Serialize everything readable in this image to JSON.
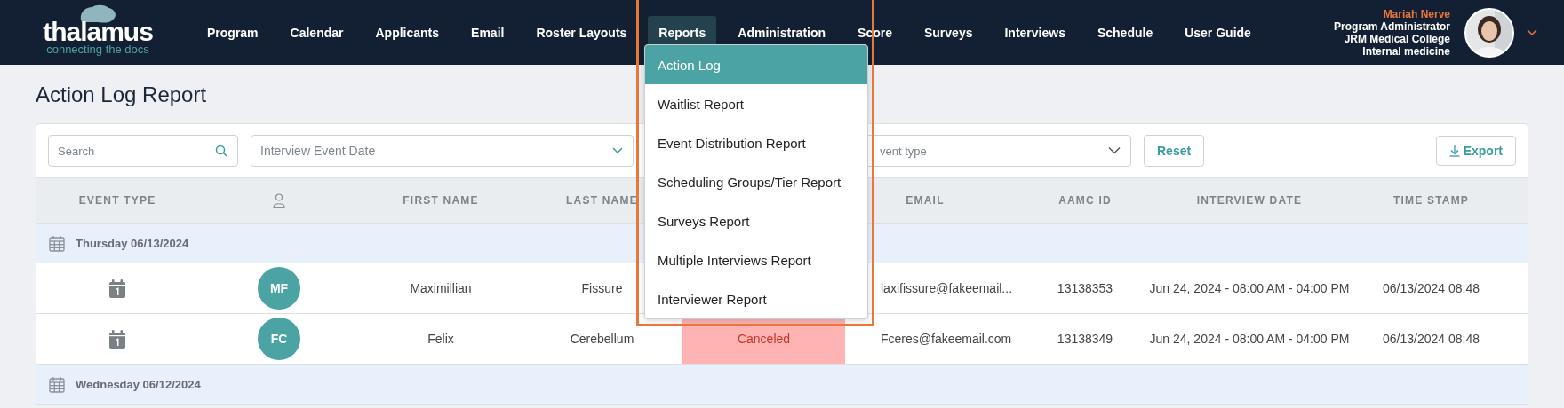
{
  "logo": {
    "name": "thalamus",
    "tagline": "connecting the docs"
  },
  "nav": [
    {
      "label": "Program",
      "selected": false
    },
    {
      "label": "Calendar",
      "selected": false
    },
    {
      "label": "Applicants",
      "selected": false
    },
    {
      "label": "Email",
      "selected": false
    },
    {
      "label": "Roster Layouts",
      "selected": false
    },
    {
      "label": "Reports",
      "selected": true
    },
    {
      "label": "Administration",
      "selected": false
    },
    {
      "label": "Score",
      "selected": false
    },
    {
      "label": "Surveys",
      "selected": false
    },
    {
      "label": "Interviews",
      "selected": false
    },
    {
      "label": "Schedule",
      "selected": false
    },
    {
      "label": "User Guide",
      "selected": false
    }
  ],
  "user": {
    "name": "Mariah Nerve",
    "role": "Program Administrator",
    "institution": "JRM Medical College",
    "department": "Internal medicine"
  },
  "reports_menu": [
    {
      "label": "Action Log",
      "selected": true
    },
    {
      "label": "Waitlist Report",
      "selected": false
    },
    {
      "label": "Event Distribution Report",
      "selected": false
    },
    {
      "label": "Scheduling Groups/Tier Report",
      "selected": false
    },
    {
      "label": "Surveys Report",
      "selected": false
    },
    {
      "label": "Multiple Interviews Report",
      "selected": false
    },
    {
      "label": "Interviewer Report",
      "selected": false
    }
  ],
  "page_title": "Action Log Report",
  "filters": {
    "search": {
      "placeholder": "Search"
    },
    "date": {
      "placeholder": "Interview Event Date"
    },
    "event_type": {
      "placeholder": "vent type"
    }
  },
  "buttons": {
    "reset": "Reset",
    "export": "Export"
  },
  "table": {
    "columns": [
      {
        "kind": "text",
        "label": "EVENT TYPE"
      },
      {
        "kind": "person"
      },
      {
        "kind": "text",
        "label": "FIRST NAME"
      },
      {
        "kind": "text",
        "label": "LAST NAME"
      },
      {
        "kind": "text",
        "label": "EMAIL"
      },
      {
        "kind": "text",
        "label": "AAMC ID"
      },
      {
        "kind": "text",
        "label": "INTERVIEW DATE"
      },
      {
        "kind": "text",
        "label": "TIME STAMP"
      }
    ],
    "groups": [
      {
        "date": "Thursday 06/13/2024",
        "rows": [
          {
            "initials": "MF",
            "first_name": "Maximillian",
            "last_name": "Fissure",
            "email": "laxifissure@fakeemail...",
            "aamc_id": "13138353",
            "interview_date": "Jun 24, 2024 - 08:00 AM - 04:00 PM",
            "time_stamp": "06/13/2024 08:48"
          },
          {
            "initials": "FC",
            "first_name": "Felix",
            "last_name": "Cerebellum",
            "status": {
              "kind": "canceled",
              "label": "Canceled"
            },
            "email": "Fceres@fakeemail.com",
            "aamc_id": "13138349",
            "interview_date": "Jun 24, 2024 - 08:00 AM - 04:00 PM",
            "time_stamp": "06/13/2024 08:48"
          }
        ]
      },
      {
        "date": "Wednesday 06/12/2024"
      }
    ]
  }
}
